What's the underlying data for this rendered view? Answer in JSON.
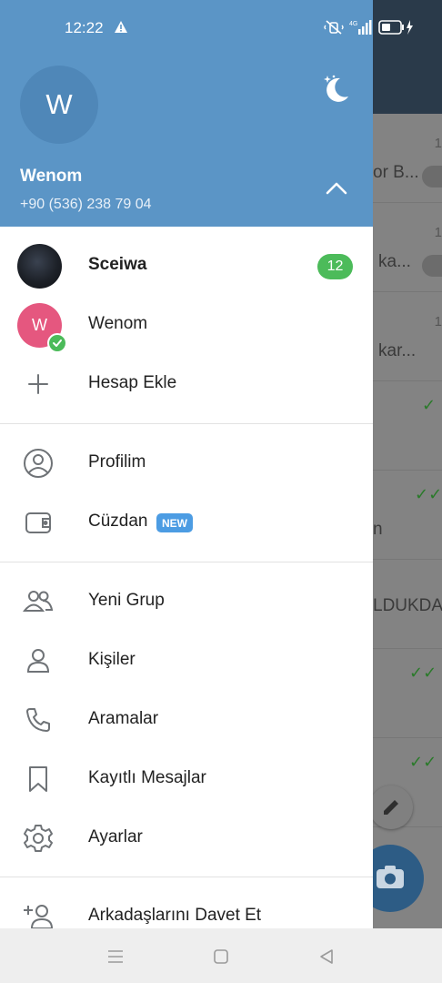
{
  "status_bar": {
    "time": "12:22",
    "icons": [
      "warning-icon",
      "mute-icon",
      "signal-icon",
      "battery-icon",
      "charging-icon"
    ]
  },
  "drawer": {
    "header": {
      "avatar_initial": "W",
      "name": "Wenom",
      "phone": "+90 (536) 238 79 04",
      "header_color": "#5b95c6"
    },
    "accounts": [
      {
        "name": "Sceiwa",
        "unread": "12",
        "active": false
      },
      {
        "name": "Wenom",
        "initial": "W",
        "active": true
      }
    ],
    "add_account": "Hesap Ekle",
    "section1": [
      {
        "label": "Profilim",
        "icon": "profile-icon"
      },
      {
        "label": "Cüzdan",
        "icon": "wallet-icon",
        "badge": "NEW"
      }
    ],
    "section2": [
      {
        "label": "Yeni Grup",
        "icon": "group-icon"
      },
      {
        "label": "Kişiler",
        "icon": "contact-icon"
      },
      {
        "label": "Aramalar",
        "icon": "phone-icon"
      },
      {
        "label": "Kayıtlı Mesajlar",
        "icon": "bookmark-icon"
      },
      {
        "label": "Ayarlar",
        "icon": "settings-icon"
      }
    ],
    "section3": [
      {
        "label": "Arkadaşlarını Davet Et",
        "icon": "invite-user-icon"
      }
    ]
  },
  "background_chats": {
    "times": [
      "1",
      "1",
      "1"
    ],
    "fragments": [
      "or B...",
      "ka...",
      "kar...",
      "LDUKDA",
      "n"
    ]
  },
  "colors": {
    "accent": "#5b95c6",
    "badge_green": "#4cbb5a",
    "new_badge": "#4c9ce3"
  }
}
